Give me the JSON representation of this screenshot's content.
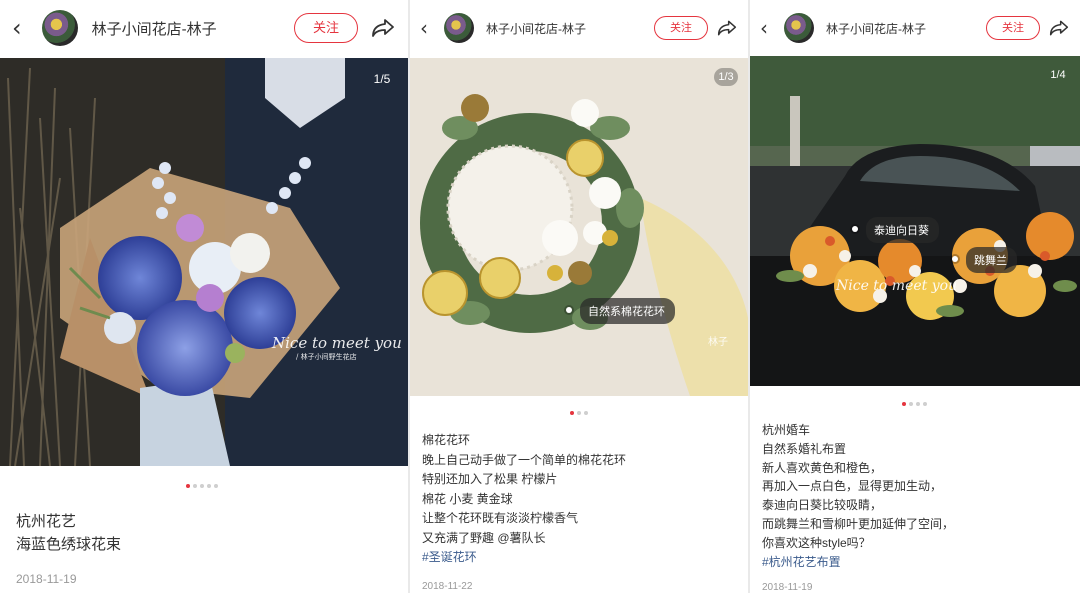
{
  "colors": {
    "accent": "#e5353f",
    "tag_blue": "#3b5b8c",
    "muted": "#999999"
  },
  "panels": [
    {
      "shop_name": "林子小间花店-林子",
      "follow_label": "关注",
      "icons": {
        "back": "back-arrow-icon",
        "share": "share-icon"
      },
      "counter": "1/5",
      "dots": {
        "count": 5,
        "active": 0
      },
      "watermark": "Nice to meet you",
      "watermark_sub": "/ 林子小间野生花店",
      "lines": [
        "杭州花艺",
        "海蓝色绣球花束"
      ],
      "date": "2018-11-19"
    },
    {
      "shop_name": "林子小间花店-林子",
      "follow_label": "关注",
      "icons": {
        "back": "back-arrow-icon",
        "share": "share-icon"
      },
      "counter": "1/3",
      "dots": {
        "count": 3,
        "active": 0
      },
      "tag": "自然系棉花花环",
      "watermark": "林子",
      "lines": [
        "棉花花环",
        "晚上自己动手做了一个简单的棉花花环",
        "特别还加入了松果 柠檬片",
        "棉花 小麦 黄金球",
        "让整个花环既有淡淡柠檬香气",
        "又充满了野趣 @薯队长"
      ],
      "hashtag": "#圣诞花环",
      "date": "2018-11-22"
    },
    {
      "shop_name": "林子小间花店-林子",
      "follow_label": "关注",
      "icons": {
        "back": "back-arrow-icon",
        "share": "share-icon"
      },
      "counter": "1/4",
      "dots": {
        "count": 4,
        "active": 0
      },
      "tags": [
        "泰迪向日葵",
        "跳舞兰"
      ],
      "watermark": "Nice to meet you",
      "lines": [
        "杭州婚车",
        "自然系婚礼布置",
        "新人喜欢黄色和橙色，",
        "再加入一点白色，显得更加生动，",
        "泰迪向日葵比较吸睛，",
        "而跳舞兰和雪柳叶更加延伸了空间，",
        "你喜欢这种style吗？"
      ],
      "hashtag": "#杭州花艺布置",
      "date": "2018-11-19"
    }
  ]
}
